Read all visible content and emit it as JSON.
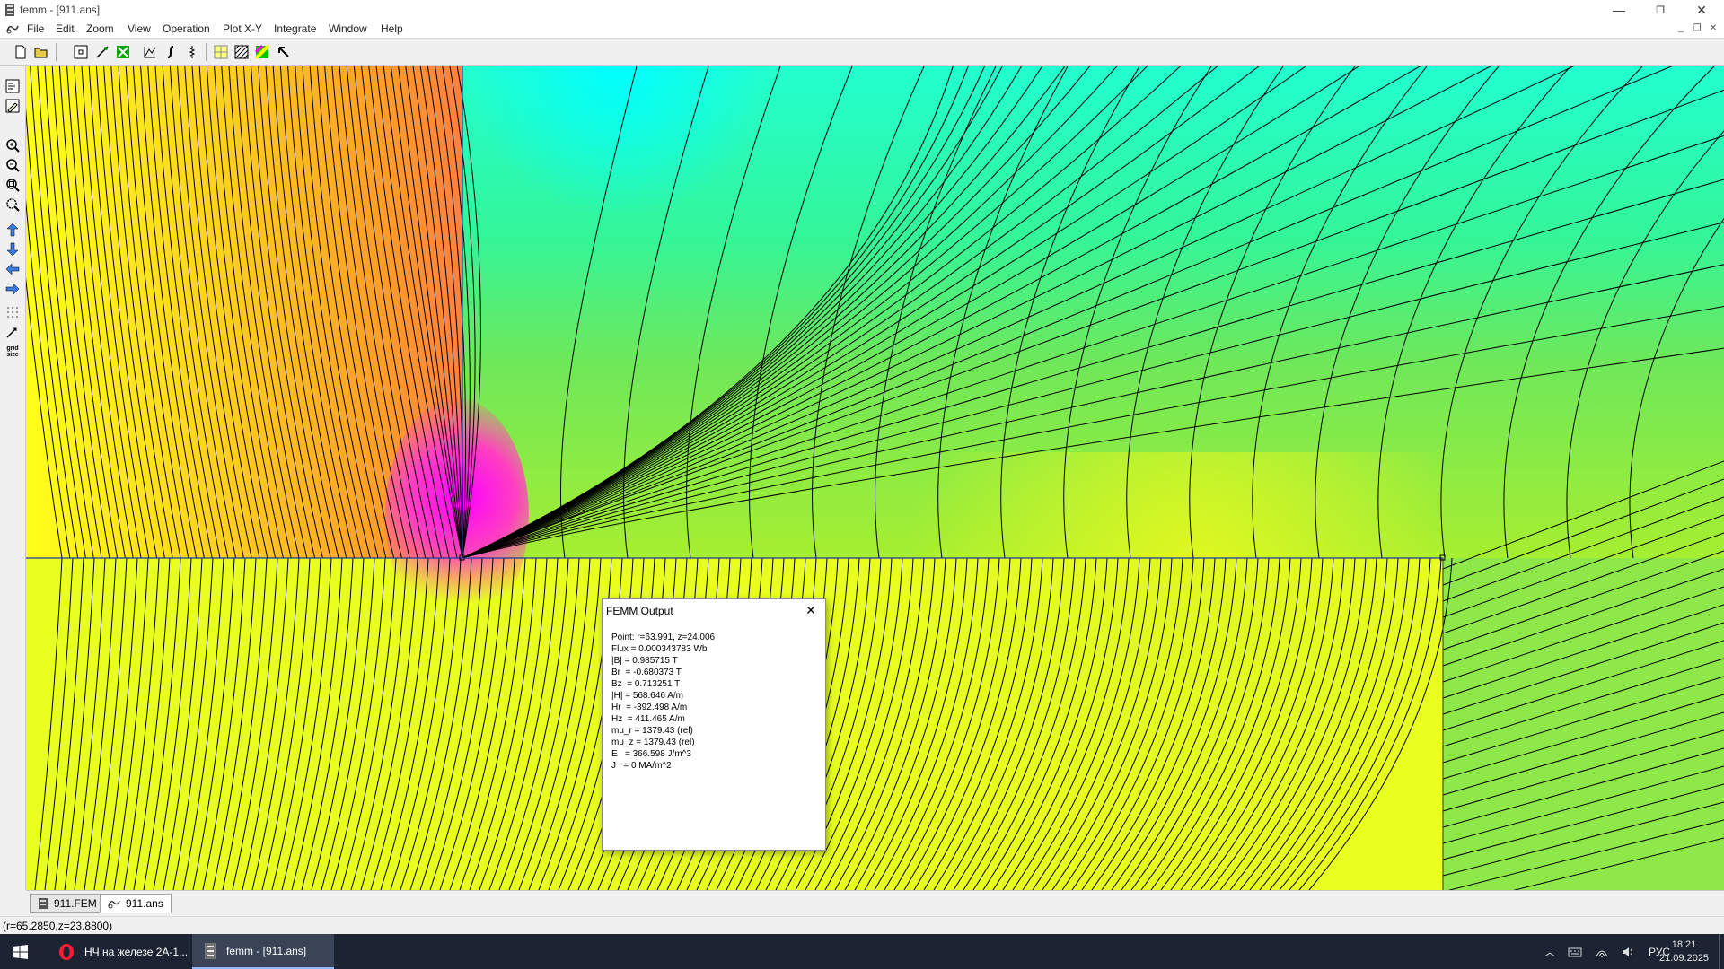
{
  "window": {
    "title": "femm - [911.ans]",
    "controls": {
      "minimize": "—",
      "restore": "❐",
      "close": "✕"
    },
    "mdi_controls": {
      "minimize": "_",
      "restore": "❐",
      "close": "✕"
    }
  },
  "menu": [
    {
      "label": "File"
    },
    {
      "label": "Edit"
    },
    {
      "label": "Zoom"
    },
    {
      "label": "View"
    },
    {
      "label": "Operation"
    },
    {
      "label": "Plot X-Y"
    },
    {
      "label": "Integrate"
    },
    {
      "label": "Window"
    },
    {
      "label": "Help"
    }
  ],
  "toolbar": {
    "icons": [
      "new-file-icon",
      "open-file-icon",
      "point-mode-icon",
      "contour-mode-icon",
      "area-mode-icon",
      "plot-xy-icon",
      "integrate-icon",
      "circuit-props-icon",
      "show-mesh-icon",
      "hatch-icon",
      "density-plot-icon",
      "pointer-icon"
    ]
  },
  "left_toolbar": {
    "icons": [
      "vector-plot-icon",
      "contour-plot-icon",
      "zoom-in-icon",
      "zoom-out-icon",
      "zoom-natural-icon",
      "zoom-window-icon",
      "pan-up-icon",
      "pan-down-icon",
      "pan-left-icon",
      "pan-right-icon",
      "show-grid-icon",
      "snap-grid-icon",
      "grid-size-icon"
    ],
    "grid_label": "grid size"
  },
  "colors": {
    "yellow": "#ffff1a",
    "orange": "#ffaa22",
    "magenta": "#ff00ff",
    "cyan": "#00ffff",
    "teal": "#22ffc8",
    "green": "#7fe04a",
    "boundary": "#1a3aa0"
  },
  "dialog": {
    "title": "FEMM Output",
    "lines": [
      "Point: r=63.991, z=24.006",
      "Flux = 0.000343783 Wb",
      "|B| = 0.985715 T",
      "Br  = -0.680373 T",
      "Bz  = 0.713251 T",
      "|H| = 568.646 A/m",
      "Hr  = -392.498 A/m",
      "Hz  = 411.465 A/m",
      "mu_r = 1379.43 (rel)",
      "mu_z = 1379.43 (rel)",
      "E   = 366.598 J/m^3",
      "J   = 0 MA/m^2"
    ]
  },
  "doc_tabs": [
    {
      "label": "911.FEM",
      "active": false
    },
    {
      "label": "911.ans",
      "active": true
    }
  ],
  "status": {
    "coords": "(r=65.2850,z=23.8800)"
  },
  "taskbar": {
    "items": [
      {
        "label": "НЧ на железе 2А-1...",
        "active": false
      },
      {
        "label": "femm - [911.ans]",
        "active": true
      }
    ],
    "tray": {
      "language": "РУС",
      "time": "18:21",
      "date": "21.09.2025"
    }
  }
}
